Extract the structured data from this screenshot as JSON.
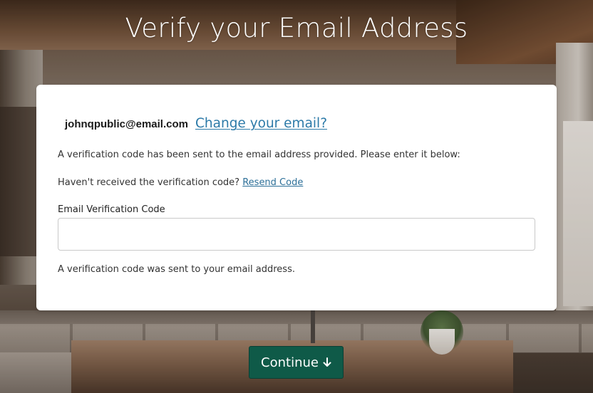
{
  "page": {
    "title": "Verify your Email Address"
  },
  "card": {
    "email": "johnqpublic@email.com",
    "change_email_link": "Change your email?",
    "sent_notice": "A verification code has been sent to the email address provided. Please enter it below:",
    "resend_prompt": "Haven't received the verification code?",
    "resend_link": "Resend Code",
    "code_field_label": "Email Verification Code",
    "code_field_value": "",
    "status_message": "A verification code was sent to your email address."
  },
  "actions": {
    "continue_label": "Continue",
    "continue_icon": "arrow-down-icon"
  },
  "colors": {
    "button_bg": "#0f5a48",
    "link": "#2c7aa8"
  }
}
